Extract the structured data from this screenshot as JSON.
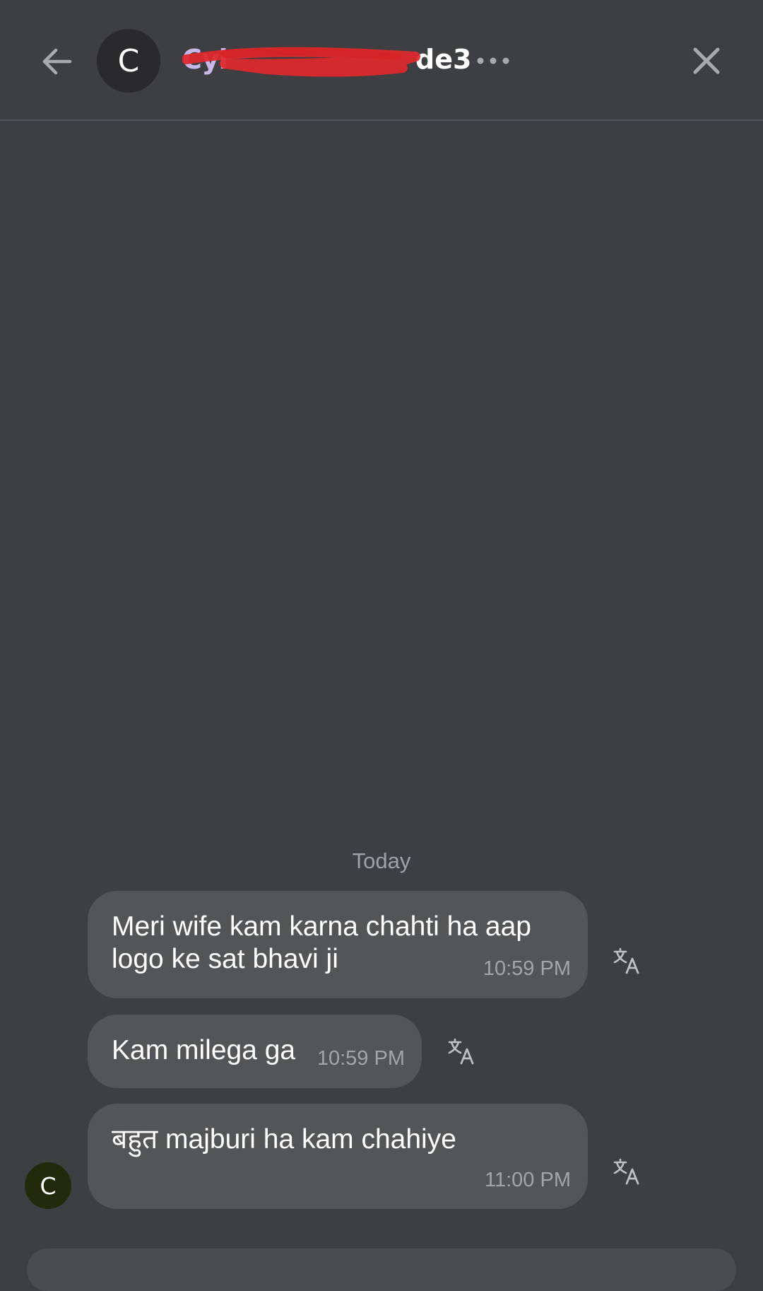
{
  "header": {
    "avatar_letter": "C",
    "title_visible_end": "de3",
    "icons": {
      "back": "arrow-left-icon",
      "more": "more-horizontal-icon",
      "close": "close-icon"
    }
  },
  "date_separator": "Today",
  "messages": [
    {
      "lines": "Meri wife kam karna chahti ha aap\nlogo ke sat bhavi ji",
      "time": "10:59 PM"
    },
    {
      "lines": "Kam milega ga",
      "time": "10:59 PM"
    },
    {
      "lines": "बहुत majburi ha kam chahiye",
      "time": "11:00 PM"
    }
  ],
  "sender_avatar_letter": "C",
  "colors": {
    "background": "#3e3f43",
    "bubble": "#545558",
    "title_redacted": "#c7b8e8",
    "redaction": "#e0282c",
    "sender_avatar": "#232a0c"
  }
}
